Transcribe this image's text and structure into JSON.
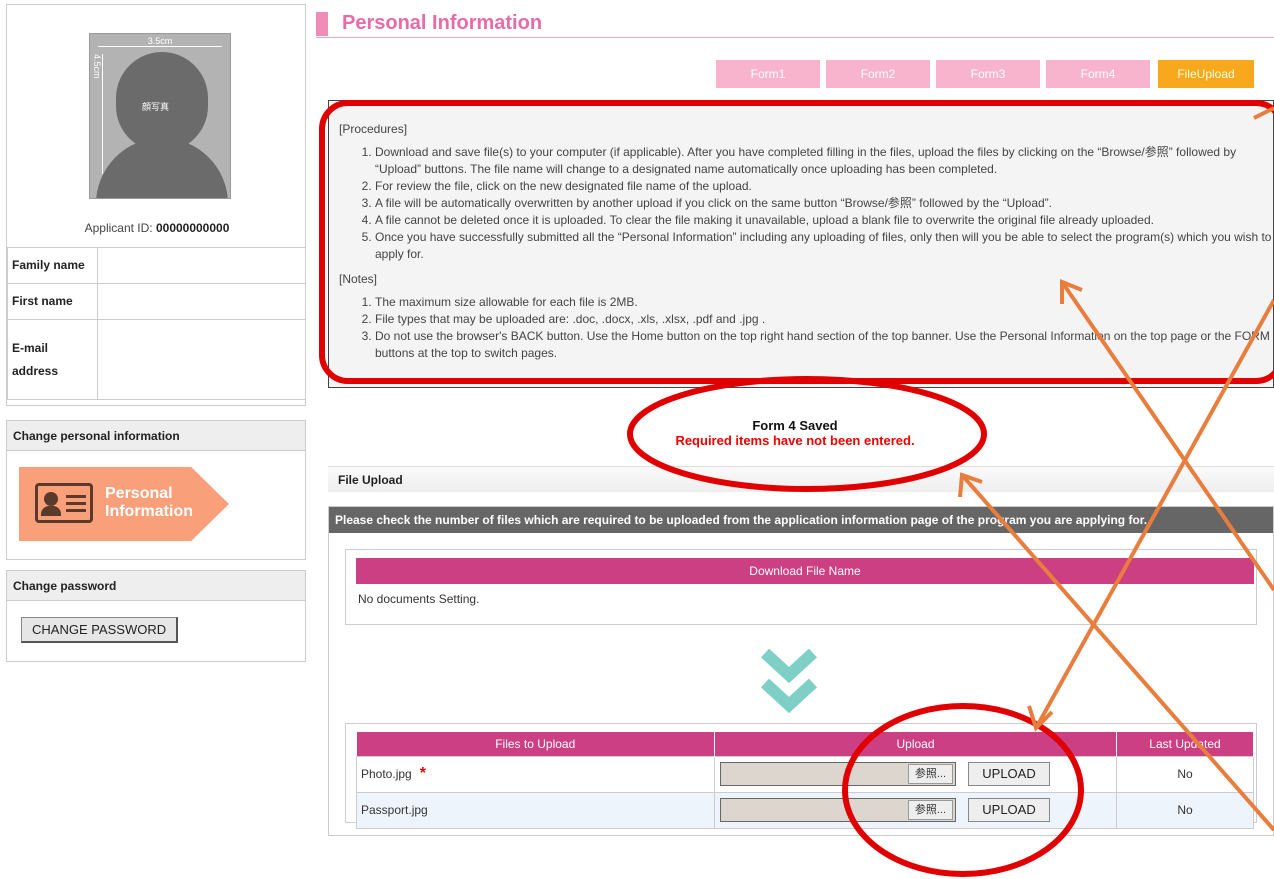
{
  "sidebar": {
    "photo_width_label": "3.5cm",
    "photo_height_label": "4.5cm",
    "photo_label": "顔写真",
    "applicant_id_label": "Applicant ID: ",
    "applicant_id_value": "00000000000",
    "fields": [
      {
        "label": "Family name",
        "value": ""
      },
      {
        "label": "First name",
        "value": ""
      },
      {
        "label": "E-mail address",
        "value": ""
      }
    ],
    "change_info_heading": "Change personal information",
    "personal_info_line1": "Personal",
    "personal_info_line2": "Information",
    "change_password_heading": "Change password",
    "change_password_button": "CHANGE PASSWORD"
  },
  "main": {
    "title": "Personal Information",
    "tabs": [
      "Form1",
      "Form2",
      "Form3",
      "Form4",
      "FileUpload"
    ],
    "active_tab": "FileUpload",
    "procedures_heading": "[Procedures]",
    "procedures": [
      "Download and save file(s) to your computer (if applicable). After you have completed filling in the files, upload the files by clicking on the “Browse/参照” followed by “Upload” buttons. The file name will change to a designated name automatically once uploading has been completed.",
      "For review the file, click on the new designated file name of the upload.",
      "A file will be automatically overwritten by another upload if you click on the same button “Browse/参照” followed by the “Upload”.",
      "A file cannot be deleted once it is uploaded. To clear the file making it unavailable, upload a blank file to overwrite the original file already uploaded.",
      "Once you have successfully submitted all the “Personal Information” including any uploading of files, only then will you be able to select the program(s) which you wish to apply for."
    ],
    "notes_heading": "[Notes]",
    "notes": [
      "The maximum size allowable for each file is 2MB.",
      "File types that may be uploaded are: .doc, .docx, .xls, .xlsx, .pdf and .jpg .",
      "Do not use the browser's BACK button. Use the Home button on the top right hand section of the top banner. Use the Personal Information on the top page or the FORM buttons at the top to switch pages."
    ],
    "saved_message": "Form 4 Saved",
    "error_message": "Required items have not been entered.",
    "file_upload_heading": "File Upload",
    "instruction_bar": "Please check the number of files which are required to be uploaded from the application information page of the program you are applying for.",
    "download_table": {
      "header": "Download File Name",
      "empty_text": "No documents Setting."
    },
    "upload_table": {
      "headers": [
        "Files to Upload",
        "Upload",
        "Last Updated"
      ],
      "rows": [
        {
          "file": "Photo.jpg",
          "required_mark": "*",
          "browse": "参照...",
          "upload": "UPLOAD",
          "last_updated": "No"
        },
        {
          "file": "Passport.jpg",
          "required_mark": "",
          "browse": "参照...",
          "upload": "UPLOAD",
          "last_updated": "No"
        }
      ]
    }
  },
  "annotation_colors": {
    "circle": "#e00000",
    "arrow": "#e87d3e"
  }
}
